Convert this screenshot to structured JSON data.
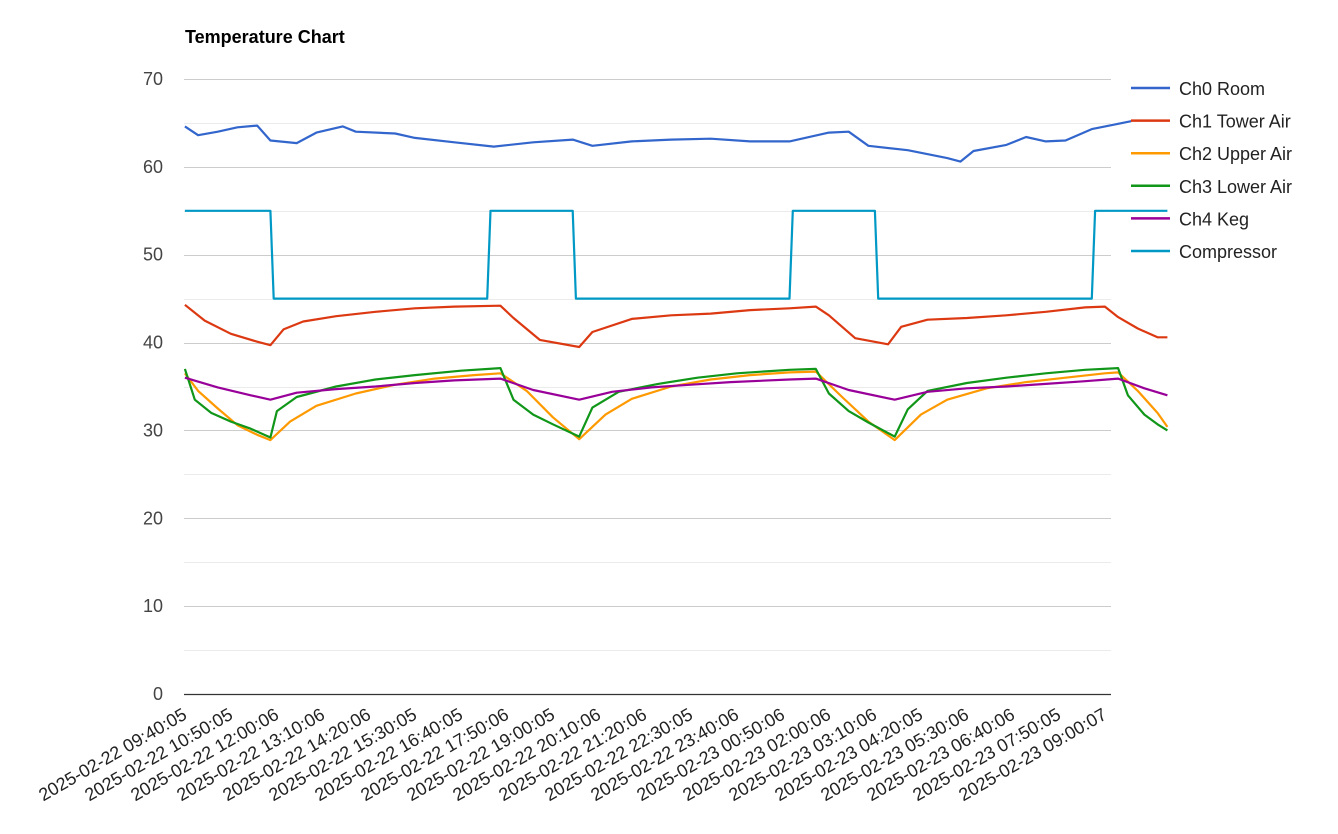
{
  "chart_data": {
    "type": "line",
    "title": "Temperature Chart",
    "xlabel": "",
    "ylabel": "",
    "ylim": [
      0,
      70
    ],
    "yticks": [
      0,
      10,
      20,
      30,
      40,
      50,
      60,
      70
    ],
    "grid": true,
    "legend_position": "right",
    "x_tick_labels": [
      "2025-02-22 09:40:05",
      "2025-02-22 10:50:05",
      "2025-02-22 12:00:06",
      "2025-02-22 13:10:06",
      "2025-02-22 14:20:06",
      "2025-02-22 15:30:05",
      "2025-02-22 16:40:05",
      "2025-02-22 17:50:06",
      "2025-02-22 19:00:05",
      "2025-02-22 20:10:06",
      "2025-02-22 21:20:06",
      "2025-02-22 22:30:05",
      "2025-02-22 23:40:06",
      "2025-02-23 00:50:06",
      "2025-02-23 02:00:06",
      "2025-02-23 03:10:06",
      "2025-02-23 04:20:05",
      "2025-02-23 05:30:06",
      "2025-02-23 06:40:06",
      "2025-02-23 07:50:05",
      "2025-02-23 09:00:07"
    ],
    "series": [
      {
        "name": "Ch0 Room",
        "color": "#3366cc",
        "points": [
          [
            "2025-02-22 09:40",
            64.6
          ],
          [
            "2025-02-22 10:00",
            63.6
          ],
          [
            "2025-02-22 10:30",
            64.0
          ],
          [
            "2025-02-22 11:00",
            64.5
          ],
          [
            "2025-02-22 11:30",
            64.7
          ],
          [
            "2025-02-22 11:50",
            63.0
          ],
          [
            "2025-02-22 12:30",
            62.7
          ],
          [
            "2025-02-22 13:00",
            63.9
          ],
          [
            "2025-02-22 13:40",
            64.6
          ],
          [
            "2025-02-22 14:00",
            64.0
          ],
          [
            "2025-02-22 15:00",
            63.8
          ],
          [
            "2025-02-22 15:30",
            63.3
          ],
          [
            "2025-02-22 16:30",
            62.8
          ],
          [
            "2025-02-22 17:30",
            62.3
          ],
          [
            "2025-02-22 18:30",
            62.8
          ],
          [
            "2025-02-22 19:30",
            63.1
          ],
          [
            "2025-02-22 20:00",
            62.4
          ],
          [
            "2025-02-22 21:00",
            62.9
          ],
          [
            "2025-02-22 22:00",
            63.1
          ],
          [
            "2025-02-22 23:00",
            63.2
          ],
          [
            "2025-02-23 00:00",
            62.9
          ],
          [
            "2025-02-23 01:00",
            62.9
          ],
          [
            "2025-02-23 02:00",
            63.9
          ],
          [
            "2025-02-23 02:30",
            64.0
          ],
          [
            "2025-02-23 03:00",
            62.4
          ],
          [
            "2025-02-23 04:00",
            61.9
          ],
          [
            "2025-02-23 05:00",
            61.0
          ],
          [
            "2025-02-23 05:20",
            60.6
          ],
          [
            "2025-02-23 05:40",
            61.8
          ],
          [
            "2025-02-23 06:30",
            62.5
          ],
          [
            "2025-02-23 07:00",
            63.4
          ],
          [
            "2025-02-23 07:30",
            62.9
          ],
          [
            "2025-02-23 08:00",
            63.0
          ],
          [
            "2025-02-23 08:40",
            64.3
          ],
          [
            "2025-02-23 09:40",
            65.2
          ]
        ]
      },
      {
        "name": "Ch1 Tower Air",
        "color": "#dc3912",
        "points": [
          [
            "2025-02-22 09:40",
            44.3
          ],
          [
            "2025-02-22 10:10",
            42.5
          ],
          [
            "2025-02-22 10:50",
            41.0
          ],
          [
            "2025-02-22 11:30",
            40.1
          ],
          [
            "2025-02-22 11:50",
            39.7
          ],
          [
            "2025-02-22 12:10",
            41.5
          ],
          [
            "2025-02-22 12:40",
            42.4
          ],
          [
            "2025-02-22 13:30",
            43.0
          ],
          [
            "2025-02-22 14:30",
            43.5
          ],
          [
            "2025-02-22 15:30",
            43.9
          ],
          [
            "2025-02-22 16:30",
            44.1
          ],
          [
            "2025-02-22 17:40",
            44.2
          ],
          [
            "2025-02-22 18:00",
            42.8
          ],
          [
            "2025-02-22 18:40",
            40.3
          ],
          [
            "2025-02-22 19:40",
            39.5
          ],
          [
            "2025-02-22 20:00",
            41.2
          ],
          [
            "2025-02-22 21:00",
            42.7
          ],
          [
            "2025-02-22 22:00",
            43.1
          ],
          [
            "2025-02-22 23:00",
            43.3
          ],
          [
            "2025-02-23 00:00",
            43.7
          ],
          [
            "2025-02-23 01:00",
            43.9
          ],
          [
            "2025-02-23 01:40",
            44.1
          ],
          [
            "2025-02-23 02:00",
            43.1
          ],
          [
            "2025-02-23 02:40",
            40.5
          ],
          [
            "2025-02-23 03:30",
            39.8
          ],
          [
            "2025-02-23 03:50",
            41.8
          ],
          [
            "2025-02-23 04:30",
            42.6
          ],
          [
            "2025-02-23 05:30",
            42.8
          ],
          [
            "2025-02-23 06:30",
            43.1
          ],
          [
            "2025-02-23 07:30",
            43.5
          ],
          [
            "2025-02-23 08:30",
            44.0
          ],
          [
            "2025-02-23 09:00",
            44.1
          ],
          [
            "2025-02-23 09:20",
            42.9
          ],
          [
            "2025-02-23 09:50",
            41.6
          ],
          [
            "2025-02-23 10:20",
            40.6
          ],
          [
            "2025-02-23 10:35",
            40.6
          ]
        ]
      },
      {
        "name": "Ch2 Upper Air",
        "color": "#ff9900",
        "points": [
          [
            "2025-02-22 09:40",
            36.5
          ],
          [
            "2025-02-22 10:00",
            34.5
          ],
          [
            "2025-02-22 10:30",
            32.5
          ],
          [
            "2025-02-22 11:00",
            30.6
          ],
          [
            "2025-02-22 11:30",
            29.5
          ],
          [
            "2025-02-22 11:50",
            28.9
          ],
          [
            "2025-02-22 12:20",
            31.0
          ],
          [
            "2025-02-22 13:00",
            32.8
          ],
          [
            "2025-02-22 14:00",
            34.2
          ],
          [
            "2025-02-22 15:00",
            35.2
          ],
          [
            "2025-02-22 16:00",
            35.9
          ],
          [
            "2025-02-22 17:00",
            36.3
          ],
          [
            "2025-02-22 17:40",
            36.5
          ],
          [
            "2025-02-22 18:20",
            34.5
          ],
          [
            "2025-02-22 19:00",
            31.5
          ],
          [
            "2025-02-22 19:40",
            29.0
          ],
          [
            "2025-02-22 20:20",
            31.8
          ],
          [
            "2025-02-22 21:00",
            33.6
          ],
          [
            "2025-02-22 22:00",
            35.0
          ],
          [
            "2025-02-22 23:00",
            35.8
          ],
          [
            "2025-02-23 00:00",
            36.3
          ],
          [
            "2025-02-23 01:00",
            36.6
          ],
          [
            "2025-02-23 01:40",
            36.7
          ],
          [
            "2025-02-23 02:20",
            33.8
          ],
          [
            "2025-02-23 03:00",
            31.0
          ],
          [
            "2025-02-23 03:40",
            28.9
          ],
          [
            "2025-02-23 04:20",
            31.8
          ],
          [
            "2025-02-23 05:00",
            33.5
          ],
          [
            "2025-02-23 06:00",
            34.8
          ],
          [
            "2025-02-23 07:00",
            35.5
          ],
          [
            "2025-02-23 08:00",
            36.0
          ],
          [
            "2025-02-23 09:00",
            36.5
          ],
          [
            "2025-02-23 09:20",
            36.6
          ],
          [
            "2025-02-23 09:50",
            34.5
          ],
          [
            "2025-02-23 10:20",
            32.0
          ],
          [
            "2025-02-23 10:35",
            30.4
          ]
        ]
      },
      {
        "name": "Ch3 Lower Air",
        "color": "#109618",
        "points": [
          [
            "2025-02-22 09:40",
            37.0
          ],
          [
            "2025-02-22 09:55",
            33.5
          ],
          [
            "2025-02-22 10:20",
            32.0
          ],
          [
            "2025-02-22 10:50",
            31.0
          ],
          [
            "2025-02-22 11:20",
            30.2
          ],
          [
            "2025-02-22 11:50",
            29.2
          ],
          [
            "2025-02-22 12:00",
            32.2
          ],
          [
            "2025-02-22 12:30",
            33.8
          ],
          [
            "2025-02-22 13:30",
            35.0
          ],
          [
            "2025-02-22 14:30",
            35.8
          ],
          [
            "2025-02-22 15:30",
            36.3
          ],
          [
            "2025-02-22 16:40",
            36.8
          ],
          [
            "2025-02-22 17:40",
            37.1
          ],
          [
            "2025-02-22 18:00",
            33.5
          ],
          [
            "2025-02-22 18:30",
            31.8
          ],
          [
            "2025-02-22 19:00",
            30.7
          ],
          [
            "2025-02-22 19:40",
            29.3
          ],
          [
            "2025-02-22 20:00",
            32.6
          ],
          [
            "2025-02-22 20:40",
            34.4
          ],
          [
            "2025-02-22 21:40",
            35.3
          ],
          [
            "2025-02-22 22:40",
            36.0
          ],
          [
            "2025-02-22 23:40",
            36.5
          ],
          [
            "2025-02-23 01:00",
            36.9
          ],
          [
            "2025-02-23 01:40",
            37.0
          ],
          [
            "2025-02-23 02:00",
            34.2
          ],
          [
            "2025-02-23 02:30",
            32.2
          ],
          [
            "2025-02-23 03:00",
            30.9
          ],
          [
            "2025-02-23 03:40",
            29.3
          ],
          [
            "2025-02-23 04:00",
            32.4
          ],
          [
            "2025-02-23 04:30",
            34.5
          ],
          [
            "2025-02-23 05:30",
            35.4
          ],
          [
            "2025-02-23 06:30",
            36.0
          ],
          [
            "2025-02-23 07:30",
            36.5
          ],
          [
            "2025-02-23 08:30",
            36.9
          ],
          [
            "2025-02-23 09:20",
            37.1
          ],
          [
            "2025-02-23 09:35",
            34.0
          ],
          [
            "2025-02-23 10:00",
            31.8
          ],
          [
            "2025-02-23 10:20",
            30.7
          ],
          [
            "2025-02-23 10:35",
            30.0
          ]
        ]
      },
      {
        "name": "Ch4 Keg",
        "color": "#990099",
        "points": [
          [
            "2025-02-22 09:40",
            36.0
          ],
          [
            "2025-02-22 10:30",
            34.9
          ],
          [
            "2025-02-22 11:20",
            34.0
          ],
          [
            "2025-02-22 11:50",
            33.5
          ],
          [
            "2025-02-22 12:30",
            34.3
          ],
          [
            "2025-02-22 13:30",
            34.7
          ],
          [
            "2025-02-22 14:30",
            35.0
          ],
          [
            "2025-02-22 15:30",
            35.4
          ],
          [
            "2025-02-22 16:30",
            35.7
          ],
          [
            "2025-02-22 17:40",
            35.9
          ],
          [
            "2025-02-22 18:30",
            34.6
          ],
          [
            "2025-02-22 19:40",
            33.5
          ],
          [
            "2025-02-22 20:30",
            34.4
          ],
          [
            "2025-02-22 21:30",
            34.9
          ],
          [
            "2025-02-22 22:30",
            35.2
          ],
          [
            "2025-02-22 23:30",
            35.5
          ],
          [
            "2025-02-23 01:00",
            35.8
          ],
          [
            "2025-02-23 01:40",
            35.9
          ],
          [
            "2025-02-23 02:30",
            34.6
          ],
          [
            "2025-02-23 03:40",
            33.5
          ],
          [
            "2025-02-23 04:30",
            34.4
          ],
          [
            "2025-02-23 05:30",
            34.8
          ],
          [
            "2025-02-23 06:30",
            35.0
          ],
          [
            "2025-02-23 07:30",
            35.3
          ],
          [
            "2025-02-23 08:30",
            35.6
          ],
          [
            "2025-02-23 09:20",
            35.9
          ],
          [
            "2025-02-23 10:00",
            34.8
          ],
          [
            "2025-02-23 10:35",
            34.0
          ]
        ]
      },
      {
        "name": "Compressor",
        "color": "#0099c6",
        "points": [
          [
            "2025-02-22 09:40",
            55
          ],
          [
            "2025-02-22 11:50",
            55
          ],
          [
            "2025-02-22 11:55",
            45
          ],
          [
            "2025-02-22 17:20",
            45
          ],
          [
            "2025-02-22 17:25",
            55
          ],
          [
            "2025-02-22 19:30",
            55
          ],
          [
            "2025-02-22 19:35",
            45
          ],
          [
            "2025-02-23 01:00",
            45
          ],
          [
            "2025-02-23 01:05",
            55
          ],
          [
            "2025-02-23 03:10",
            55
          ],
          [
            "2025-02-23 03:15",
            45
          ],
          [
            "2025-02-23 08:40",
            45
          ],
          [
            "2025-02-23 08:45",
            55
          ],
          [
            "2025-02-23 10:35",
            55
          ]
        ]
      }
    ]
  }
}
